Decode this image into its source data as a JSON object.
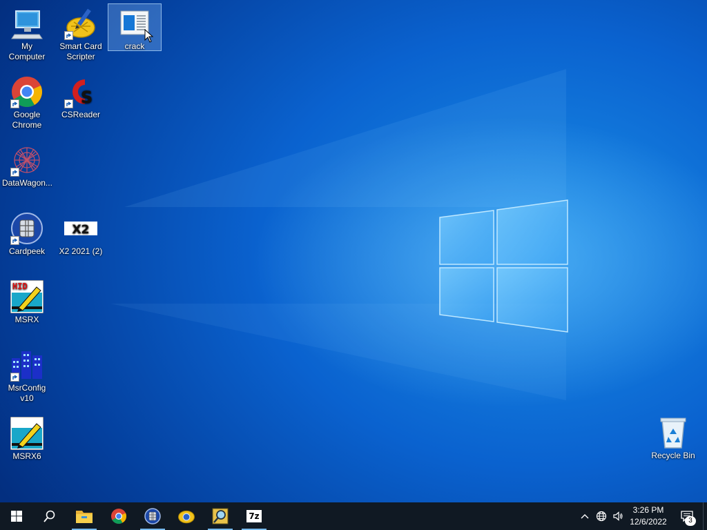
{
  "desktop": {
    "icons": [
      {
        "label": "My Computer",
        "shortcut": false
      },
      {
        "label": "Smart Card Scripter",
        "shortcut": true
      },
      {
        "label": "crack",
        "shortcut": false,
        "selected": true
      },
      {
        "label": "Google Chrome",
        "shortcut": true
      },
      {
        "label": "CSReader",
        "shortcut": true
      },
      {
        "label": "DataWagon...",
        "shortcut": true
      },
      {
        "label": "Cardpeek",
        "shortcut": true
      },
      {
        "label": "X2 2021 (2)",
        "shortcut": false,
        "badge_text": "X2"
      },
      {
        "label": "MSRX",
        "shortcut": false,
        "badge_text": "HID"
      },
      {
        "label": "MsrConfig v10",
        "shortcut": true
      },
      {
        "label": "MSRX6",
        "shortcut": false
      },
      {
        "label": "Recycle Bin",
        "shortcut": false
      }
    ]
  },
  "taskbar": {
    "pinned": [
      {
        "name": "start-icon"
      },
      {
        "name": "search-icon"
      },
      {
        "name": "file-explorer-icon",
        "active": true
      },
      {
        "name": "chrome-icon"
      },
      {
        "name": "cardpeek-icon",
        "active": true
      },
      {
        "name": "smart-card-scripter-icon"
      },
      {
        "name": "magnifier-app-icon",
        "active": true
      },
      {
        "name": "7zip-icon",
        "active": true,
        "text": "7z"
      }
    ],
    "tray": {
      "time": "3:26 PM",
      "date": "12/6/2022",
      "notification_count": "3"
    }
  },
  "colors": {
    "taskbar": "#101923",
    "accent": "#76b9ed",
    "wallpaper": "#0a62cf"
  }
}
